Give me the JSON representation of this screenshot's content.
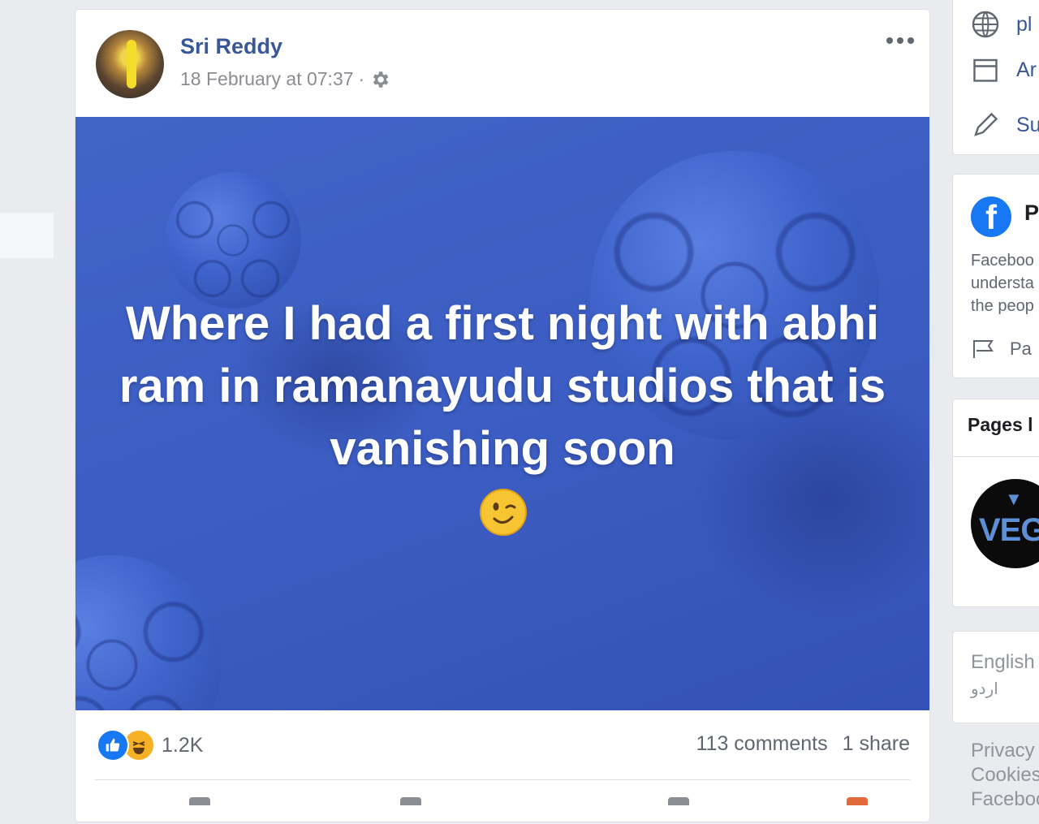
{
  "post": {
    "author": "Sri Reddy",
    "timestamp": "18 February at 07:37",
    "separator": "·",
    "text": "Where I had a first night with abhi ram in ramanayudu studios that is vanishing soon",
    "reaction_count": "1.2K",
    "comments": "113 comments",
    "shares": "1 share",
    "image_bg_color": "#3b5cc2"
  },
  "sidebar": {
    "links": [
      {
        "icon": "globe-icon",
        "label": "pl"
      },
      {
        "icon": "calendar-icon",
        "label": "Ar"
      },
      {
        "icon": "pencil-icon",
        "label": "Su"
      }
    ],
    "fb_card": {
      "title": "P",
      "description": [
        "Faceboo",
        "understa",
        "the peop"
      ],
      "page_link": "Pa"
    },
    "pages_card": {
      "header": "Pages l",
      "page_logo_text": "VEGI"
    },
    "languages": [
      "English",
      "اردو"
    ],
    "footer": [
      "Privacy",
      "Cookies",
      "Faceboo"
    ]
  },
  "colors": {
    "link": "#385898",
    "like": "#1877f2",
    "haha": "#f7b125"
  }
}
